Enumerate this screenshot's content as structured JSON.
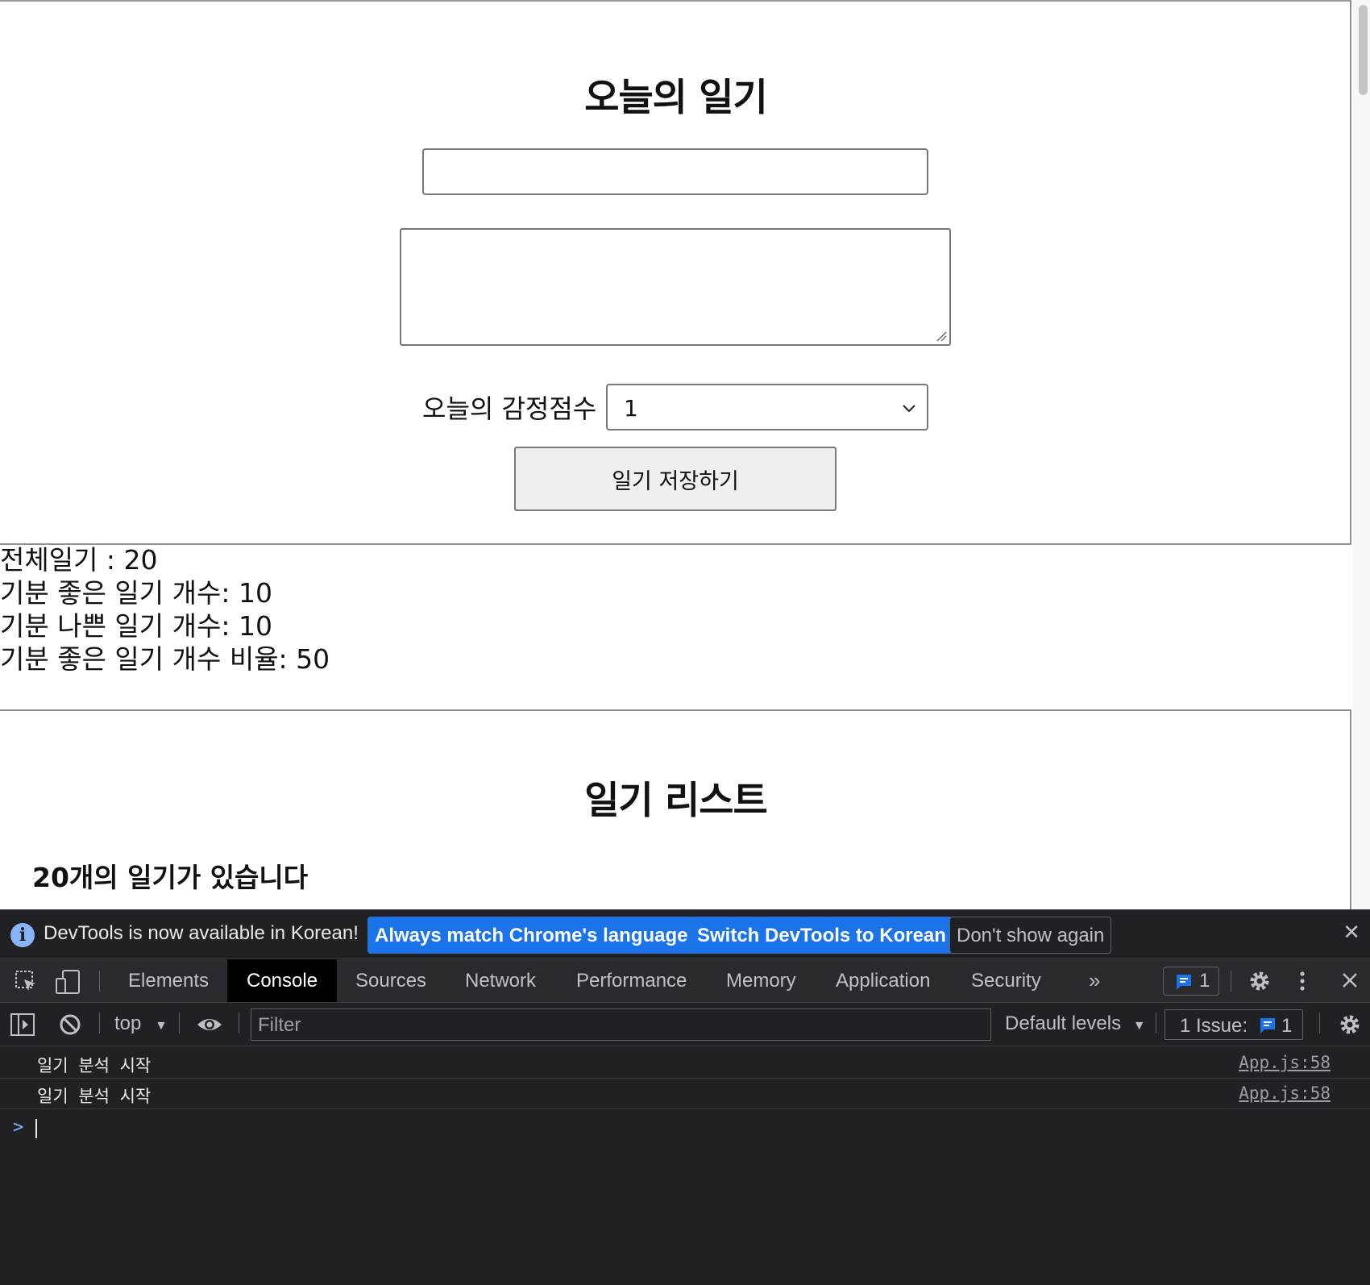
{
  "editor": {
    "title": "오늘의 일기",
    "author_value": "",
    "content_value": "",
    "emotion_label": "오늘의 감정점수 :",
    "emotion_selected": "1",
    "save_label": "일기 저장하기"
  },
  "stats": {
    "total": "전체일기 : 20",
    "good": "기분 좋은 일기 개수: 10",
    "bad": "기분 나쁜 일기 개수: 10",
    "ratio": "기분 좋은 일기 개수 비율: 50"
  },
  "list": {
    "title": "일기 리스트",
    "count_text": "20개의 일기가 있습니다"
  },
  "devtools": {
    "infobar": {
      "message": "DevTools is now available in Korean!",
      "match_label": "Always match Chrome's language",
      "switch_label": "Switch DevTools to Korean",
      "dismiss_label": "Don't show again"
    },
    "tabs": [
      "Elements",
      "Console",
      "Sources",
      "Network",
      "Performance",
      "Memory",
      "Application",
      "Security"
    ],
    "active_tab": "Console",
    "message_badge_count": "1",
    "filter": {
      "context": "top",
      "placeholder": "Filter",
      "levels": "Default levels",
      "issues_label": "1 Issue:",
      "issues_count": "1"
    },
    "console": {
      "logs": [
        {
          "message": "일기 분석 시작",
          "source": "App.js:58"
        },
        {
          "message": "일기 분석 시작",
          "source": "App.js:58"
        }
      ],
      "prompt_symbol": ">"
    },
    "colors": {
      "accent": "#1a73e8",
      "background": "#202124",
      "link": "#8ab4f8"
    }
  }
}
